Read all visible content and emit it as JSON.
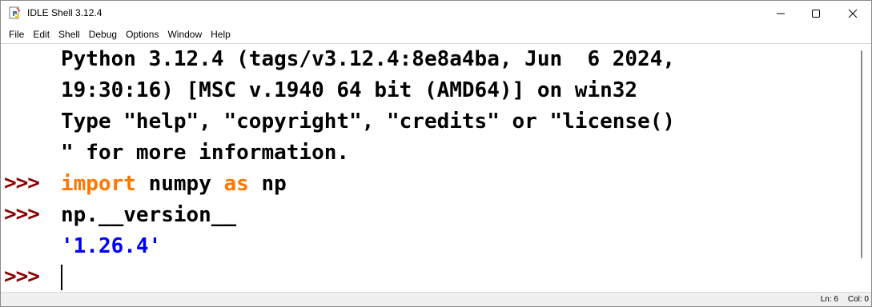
{
  "window": {
    "title": "IDLE Shell 3.12.4"
  },
  "icons": {
    "app": "idle-python-icon",
    "minimize": "minimize-icon",
    "maximize": "maximize-icon",
    "close": "close-icon"
  },
  "menu": [
    "File",
    "Edit",
    "Shell",
    "Debug",
    "Options",
    "Window",
    "Help"
  ],
  "shell": {
    "prompt": ">>>",
    "banner": [
      "Python 3.12.4 (tags/v3.12.4:8e8a4ba, Jun  6 2024,",
      "19:30:16) [MSC v.1940 64 bit (AMD64)] on win32",
      "Type \"help\", \"copyright\", \"credits\" or \"license()",
      "\" for more information."
    ],
    "input1": {
      "kw1": "import",
      "mid": " numpy ",
      "kw2": "as",
      "end": " np"
    },
    "input2": "np.__version__",
    "output": "'1.26.4'"
  },
  "status": {
    "ln": "Ln: 6",
    "col": "Col: 0"
  },
  "colors": {
    "prompt": "#8b0000",
    "keyword": "#ff7700",
    "output": "#0000ff"
  }
}
